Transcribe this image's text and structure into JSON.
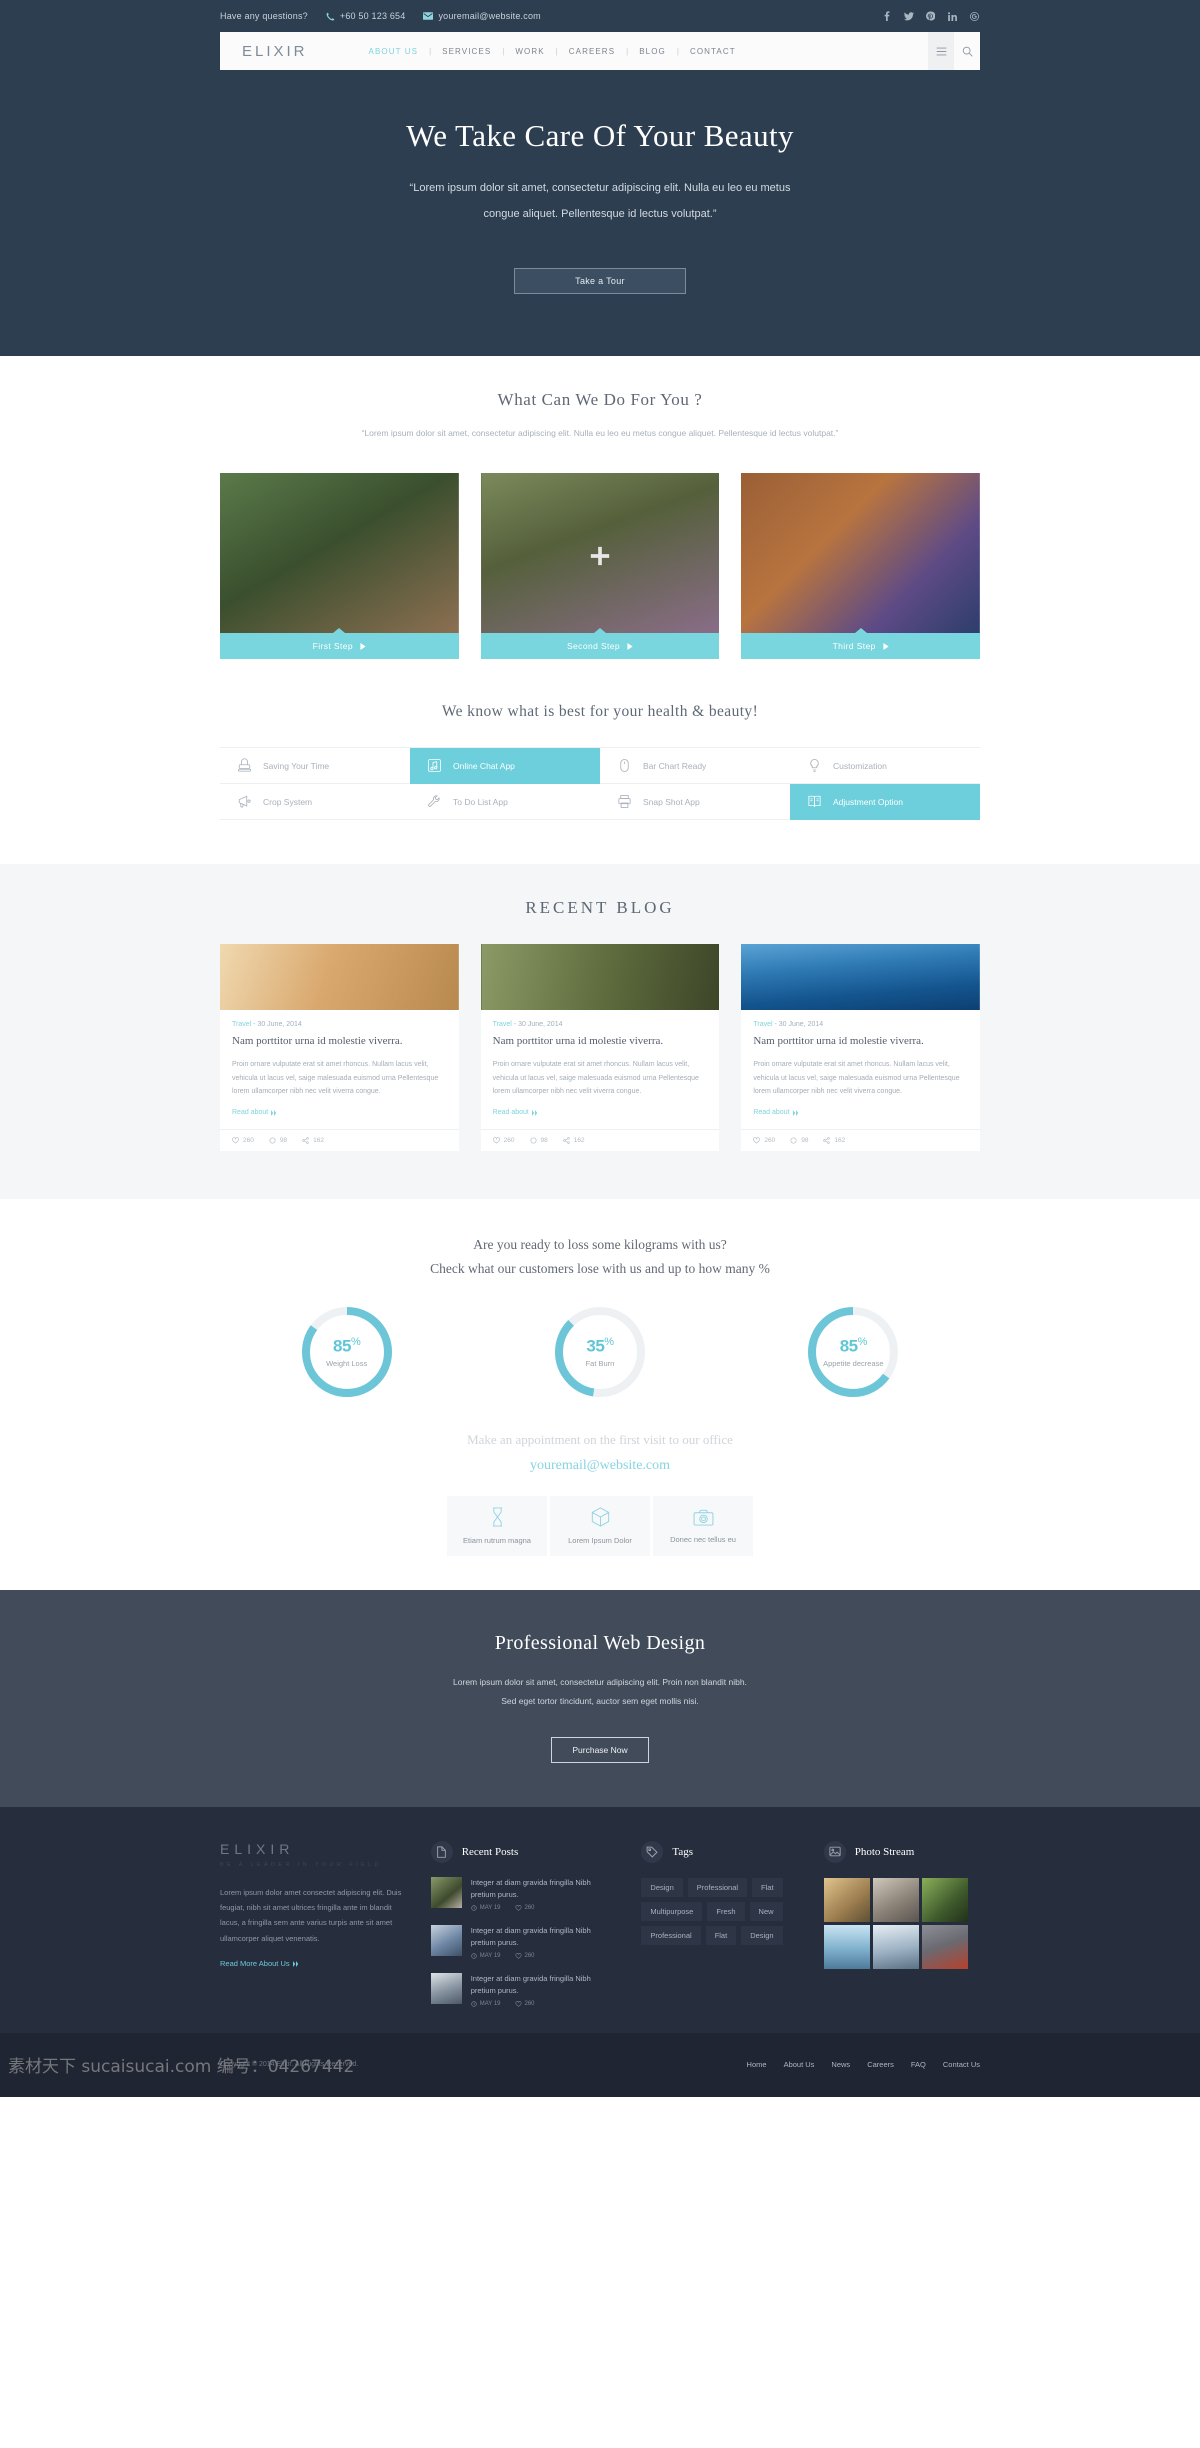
{
  "topbar": {
    "question": "Have any questions?",
    "phone": "+60 50 123 654",
    "email": "youremail@website.com",
    "socials": [
      "facebook-icon",
      "twitter-icon",
      "pinterest-icon",
      "linkedin-icon",
      "google-plus-icon"
    ]
  },
  "nav": {
    "brand": "ELIXIR",
    "items": [
      {
        "label": "ABOUT US",
        "active": true
      },
      {
        "label": "SERVICES",
        "active": false
      },
      {
        "label": "WORK",
        "active": false
      },
      {
        "label": "CAREERS",
        "active": false
      },
      {
        "label": "BLOG",
        "active": false
      },
      {
        "label": "CONTACT",
        "active": false
      }
    ],
    "tools": [
      "list-icon",
      "search-icon"
    ]
  },
  "hero": {
    "title": "We Take Care Of Your Beauty",
    "paragraph": "“Lorem ipsum dolor sit amet, consectetur adipiscing elit. Nulla eu leo eu metus congue aliquet. Pellentesque id lectus volutpat.”",
    "button": "Take a Tour"
  },
  "services": {
    "title": "What Can We Do For You ?",
    "subtitle": "“Lorem ipsum dolor sit amet, consectetur adipiscing elit. Nulla eu leo eu metus congue aliquet. Pellentesque id lectus volutpat.”",
    "cards": [
      {
        "caption": "First Step",
        "color1": "#4c6b3e",
        "color2": "#2f4127"
      },
      {
        "caption": "Second Step",
        "color1": "#6f7f58",
        "color2": "#46503a"
      },
      {
        "caption": "Third Step",
        "color1": "#a86a3d",
        "color2": "#5f4a8a"
      }
    ]
  },
  "features": {
    "title": "We know what is best for your health & beauty!",
    "items": [
      {
        "label": "Saving Your Time",
        "icon": "stamp-icon",
        "active": false
      },
      {
        "label": "Online Chat App",
        "icon": "music-note-icon",
        "active": true
      },
      {
        "label": "Bar Chart Ready",
        "icon": "mouse-icon",
        "active": false
      },
      {
        "label": "Customization",
        "icon": "lightbulb-icon",
        "active": false
      },
      {
        "label": "Crop System",
        "icon": "megaphone-icon",
        "active": false
      },
      {
        "label": "To Do List App",
        "icon": "wrench-icon",
        "active": false
      },
      {
        "label": "Snap Shot App",
        "icon": "printer-icon",
        "active": false
      },
      {
        "label": "Adjustment Option",
        "icon": "book-icon",
        "active": true
      }
    ]
  },
  "blog": {
    "title": "RECENT BLOG",
    "posts": [
      {
        "category": "Travel",
        "date": "30 June, 2014",
        "heading": "Nam porttitor urna id molestie viverra.",
        "excerpt": "Proin ornare vulputate erat sit amet rhoncus. Nullam lacus velit, vehicula ut lacus vel, saige malesuada euismod urna Pellentesque  lorem ullamcorper nibh nec velit viverra congue.",
        "read": "Read about",
        "likes": "260",
        "comments": "98",
        "shares": "162",
        "color1": "#e8c79a",
        "color2": "#cfa06b"
      },
      {
        "category": "Travel",
        "date": "30 June, 2014",
        "heading": "Nam porttitor urna id molestie viverra.",
        "excerpt": "Proin ornare vulputate erat sit amet rhoncus. Nullam lacus velit, vehicula ut lacus vel, saige malesuada euismod urna Pellentesque  lorem ullamcorper nibh nec velit viverra congue.",
        "read": "Read about",
        "likes": "260",
        "comments": "98",
        "shares": "162",
        "color1": "#7d8a5a",
        "color2": "#4a5232"
      },
      {
        "category": "Travel",
        "date": "30 June, 2014",
        "heading": "Nam porttitor urna id molestie viverra.",
        "excerpt": "Proin ornare vulputate erat sit amet rhoncus. Nullam lacus velit, vehicula ut lacus vel, saige malesuada euismod urna Pellentesque  lorem ullamcorper nibh nec velit viverra congue.",
        "read": "Read about",
        "likes": "260",
        "comments": "98",
        "shares": "162",
        "color1": "#2e6ea8",
        "color2": "#12477a"
      }
    ]
  },
  "chart_data": {
    "type": "pie",
    "title": "Check what our customers lose with us and up to how many %",
    "categories": [
      "Weight Loss",
      "Fat Burn",
      "Appetite decrease"
    ],
    "values": [
      85,
      35,
      85
    ],
    "unit": "%",
    "track_color": "#eef1f3",
    "fill_color": "#6cc6d8",
    "legend": "inside"
  },
  "stats": {
    "line1": "Are you ready to loss some kilograms with us?",
    "line2": "Check what our customers lose with us and up to how many %",
    "circles": [
      {
        "pct": "85",
        "sup": "%",
        "label": "Weight Loss",
        "value": 85
      },
      {
        "pct": "35",
        "sup": "%",
        "label": "Fat Burn",
        "value": 35
      },
      {
        "pct": "85",
        "sup": "%",
        "label": "Appetite decrease",
        "value": 85
      }
    ],
    "appointment": "Make an appointment on the first visit to our office",
    "email": "youremail@website.com",
    "boxes": [
      {
        "label": "Etiam rutrum magna",
        "icon": "hourglass-icon"
      },
      {
        "label": "Lorem Ipsum Dolor",
        "icon": "cube-icon"
      },
      {
        "label": "Donec nec tellus eu",
        "icon": "camera-icon"
      }
    ]
  },
  "cta": {
    "title": "Professional Web Design",
    "line1": "Lorem ipsum dolor sit amet, consectetur adipiscing elit. Proin non blandit nibh.",
    "line2": "Sed eget tortor tincidunt, auctor sem eget mollis nisi.",
    "button": "Purchase Now"
  },
  "footer": {
    "brand": "ELIXIR",
    "tagline": "BE A LEADER IN YOUR FIELD",
    "about": "Lorem ipsum dolor amet consectet adipiscing elit. Duis feugiat, nibh sit amet ultrices fringilla ante im blandit lacus, a fringilla sem ante varius turpis ante sit amet ullamcorper aliquet venenatis.",
    "read_more": "Read More About Us",
    "recent_posts": {
      "title": "Recent Posts",
      "icon": "document-icon",
      "items": [
        {
          "text": "Integer at diam gravida fringilla Nibh pretium purus.",
          "date": "MAY 19",
          "likes": "260",
          "color1": "#6b7a50",
          "color2": "#3b442c"
        },
        {
          "text": "Integer at diam gravida fringilla Nibh pretium purus.",
          "date": "MAY 19",
          "likes": "260",
          "color1": "#8aa6c8",
          "color2": "#4c6480"
        },
        {
          "text": "Integer at diam gravida fringilla Nibh pretium purus.",
          "date": "MAY 19",
          "likes": "260",
          "color1": "#9aa8b4",
          "color2": "#5d6a76"
        }
      ]
    },
    "tags": {
      "title": "Tags",
      "icon": "tag-icon",
      "items": [
        "Design",
        "Professional",
        "Flat",
        "Multipurpose",
        "Fresh",
        "New",
        "Professional",
        "Flat",
        "Design"
      ]
    },
    "photo_stream": {
      "title": "Photo Stream",
      "icon": "image-icon",
      "photos": [
        {
          "color1": "#c9a877",
          "color2": "#7d6440"
        },
        {
          "color1": "#b9b2a6",
          "color2": "#6d6760"
        },
        {
          "color1": "#6f8f4a",
          "color2": "#33462a"
        },
        {
          "color1": "#9fd0e8",
          "color2": "#5d87a8"
        },
        {
          "color1": "#cfdbe6",
          "color2": "#7e95ab"
        },
        {
          "color1": "#b4442f",
          "color2": "#5d5a60"
        }
      ]
    }
  },
  "bottom": {
    "copyright": "Copyright © 2014 Elixir. All Rights Reserved.",
    "links": [
      "Home",
      "About Us",
      "News",
      "Careers",
      "FAQ",
      "Contact Us"
    ]
  },
  "watermark": "素材天下 sucaisucai.com 编号：04267442"
}
